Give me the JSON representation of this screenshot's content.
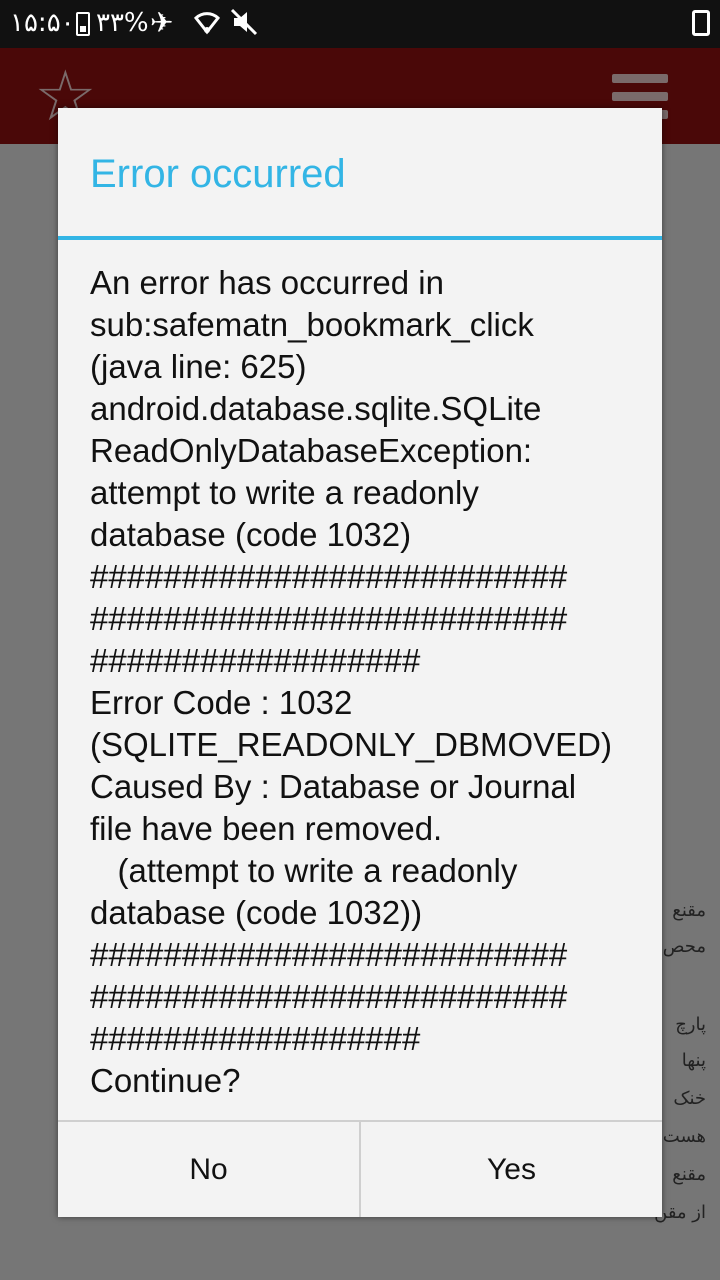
{
  "status_bar": {
    "time": "۱۵:۵۰",
    "battery_percent": "۳۳%"
  },
  "dialog": {
    "title": "Error occurred",
    "message": "An error has occurred in\nsub:safematn_bookmark_click\n(java line: 625)\nandroid.database.sqlite.SQLite\nReadOnlyDatabaseException:\nattempt to write a readonly\ndatabase (code 1032)\n##########################\n##########################\n##################\nError Code : 1032\n(SQLITE_READONLY_DBMOVED)\nCaused By : Database or Journal\nfile have been removed.\n   (attempt to write a readonly\ndatabase (code 1032))\n##########################\n##########################\n##################\nContinue?",
    "no_label": "No",
    "yes_label": "Yes"
  },
  "background": {
    "lines": [
      "مقنع",
      "محص",
      "پارچ",
      "پنها",
      "خنک",
      "هست",
      "مقنع",
      "از مقن"
    ]
  }
}
